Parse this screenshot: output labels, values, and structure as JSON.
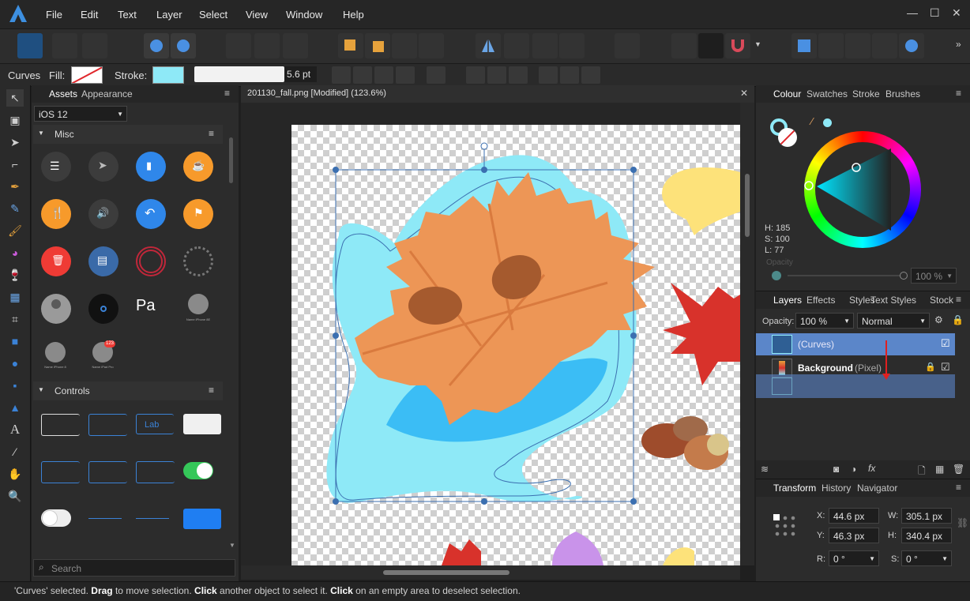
{
  "menu": [
    "File",
    "Edit",
    "Text",
    "Layer",
    "Select",
    "View",
    "Window",
    "Help"
  ],
  "context": {
    "tool": "Curves",
    "fill_label": "Fill:",
    "stroke_label": "Stroke:",
    "stroke_width": "5.6 pt"
  },
  "assets_panel": {
    "tabs": [
      "Assets",
      "Appearance"
    ],
    "category": "iOS 12",
    "section_misc": "Misc",
    "section_controls": "Controls",
    "control_label": "Lab",
    "device_labels": [
      "Name\niPhone 8",
      "Name\niPad Pro",
      "Name\niPhone 8E"
    ],
    "badge": "123",
    "search_placeholder": "Search"
  },
  "document": {
    "tab_title": "201130_fall.png [Modified] (123.6%)"
  },
  "colour_panel": {
    "tabs": [
      "Colour",
      "Swatches",
      "Stroke",
      "Brushes"
    ],
    "h": "H: 185",
    "s": "S: 100",
    "l": "L: 77",
    "opacity_label": "Opacity",
    "opacity_value": "100 %"
  },
  "layers_panel": {
    "tabs": [
      "Layers",
      "Effects",
      "Styles",
      "Text Styles",
      "Stock"
    ],
    "opacity_label": "Opacity:",
    "opacity_value": "100 %",
    "blend": "Normal",
    "layers": [
      {
        "name": "(Curves)"
      },
      {
        "name": "Background",
        "type": "(Pixel)"
      }
    ]
  },
  "transform_panel": {
    "tabs": [
      "Transform",
      "History",
      "Navigator"
    ],
    "x_label": "X:",
    "x": "44.6 px",
    "y_label": "Y:",
    "y": "46.3 px",
    "w_label": "W:",
    "w": "305.1 px",
    "h_label": "H:",
    "h": "340.4 px",
    "r_label": "R:",
    "r": "0 °",
    "s_label": "S:",
    "s": "0 °"
  },
  "status": {
    "p1": "'Curves' selected. ",
    "b1": "Drag",
    "p2": " to move selection. ",
    "b2": "Click",
    "p3": " another object to select it. ",
    "b3": "Click",
    "p4": " on an empty area to deselect selection."
  },
  "colors": {
    "accent": "#3b82d6",
    "stroke": "#8ee9f7",
    "selection": "#5b86c9"
  }
}
